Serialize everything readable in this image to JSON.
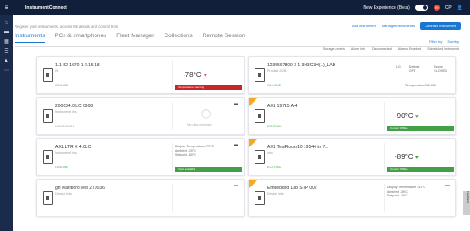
{
  "app": {
    "brand": "InstrumentConnect",
    "new_experience": "New Experience (Beta)",
    "notifications": "99",
    "user": "CP"
  },
  "header": {
    "help": "Register your instruments, access full details and control from",
    "add": "Add instrument",
    "manage": "Manage instruments",
    "connect": "Connect Instrument"
  },
  "tabs": [
    "Instruments",
    "PCs & smartphones",
    "Fleet Manager",
    "Collections",
    "Remote Session"
  ],
  "search": {
    "filter": "Filter by",
    "sort": "Sort by"
  },
  "legend": [
    "Storage Levels",
    "Alarm info",
    "Disconnected",
    "Alarms Enabled",
    "Scheduled instrument"
  ],
  "cards": [
    {
      "name": "1.1 52 1670 1 2.15 18",
      "sub": "IS",
      "status": "ONLINE",
      "temp": "-78°C",
      "pill": "Temperature warning",
      "pill_color": "red"
    },
    {
      "name": "1234567800 3 1 3H3C3H(..)_LAB",
      "sub": "Product 2033",
      "status": "ON LINE",
      "stats": [
        "LG",
        "Defrost OFF",
        "Doors CLOSED"
      ],
      "pill": "Temperature 36.980"
    },
    {
      "name": "200634.0 LC 0908",
      "sub": "Instrument info",
      "status": "UNKNOWN",
      "center": "No data received",
      "pill": ""
    },
    {
      "name": "AXL 19715 A-4",
      "sub": "",
      "status": "ECORAL",
      "temp": "-90°C",
      "pill": "Current Offline",
      "pill_color": "green"
    },
    {
      "name": "AXL LTR X 4.0LC",
      "sub": "Instrument info",
      "status": "ONLINE",
      "mini": [
        "Display Temperature -79°C",
        "Ambient -20°C",
        "Setpoint -80°C"
      ],
      "pill": "Instr. available",
      "pill_color": "green"
    },
    {
      "name": "AXL TestRoom10 19544 in 7...",
      "sub": "info",
      "status": "ECORAL",
      "temp": "-89°C",
      "pill": "Current Offline",
      "pill_color": "green"
    },
    {
      "name": "gh MarlboroTest 270036",
      "sub": "Device info",
      "status": "",
      "pill": ""
    },
    {
      "name": "Embedded Lab STP 002",
      "sub": "Device info",
      "status": "",
      "mini": [
        "Display Temperature -41°C",
        "Ambient -39°C",
        "Setpoint -40°C"
      ],
      "pill": ""
    }
  ],
  "feedback": "Feedback"
}
